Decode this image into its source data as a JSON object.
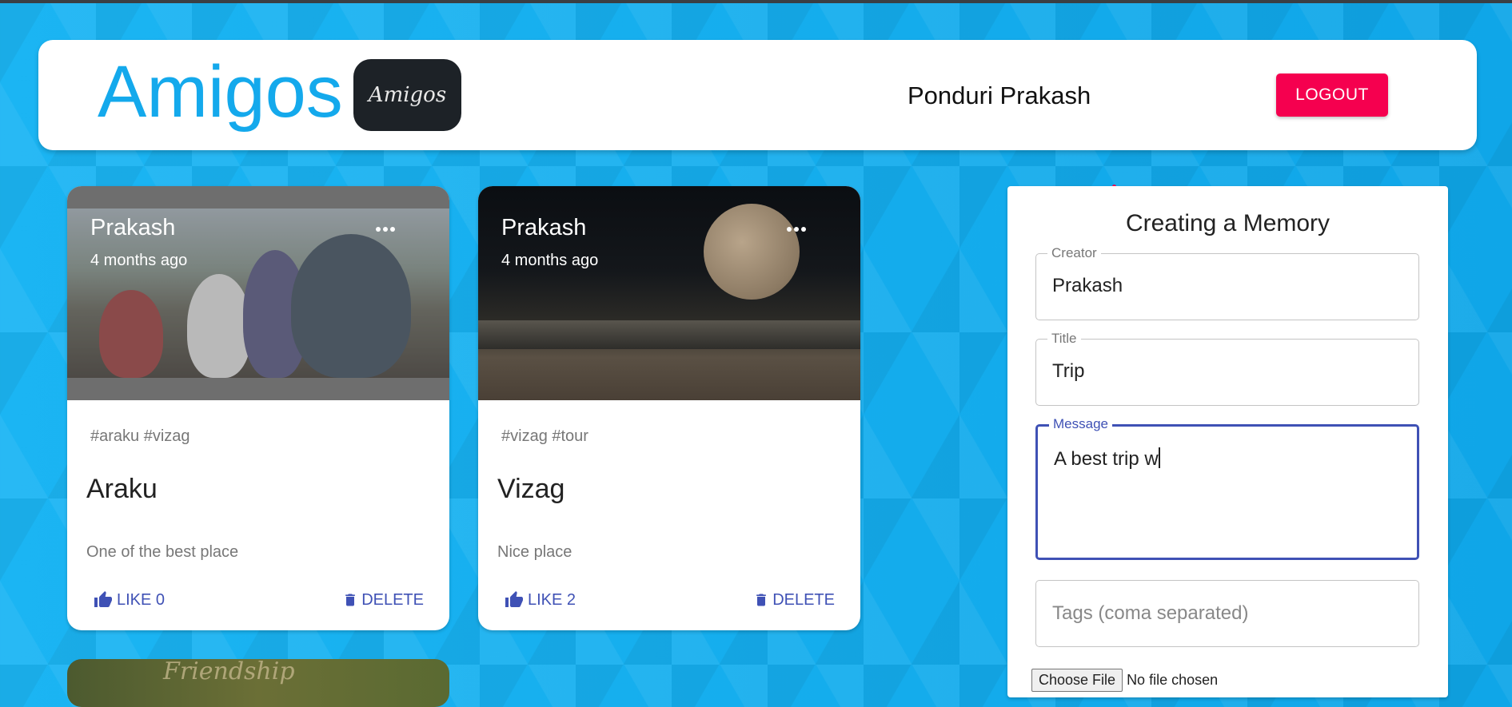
{
  "app": {
    "brand": "Amigos",
    "logo_text": "Amigos",
    "username": "Ponduri Prakash",
    "logout_label": "LOGOUT"
  },
  "posts": [
    {
      "creator": "Prakash",
      "time": "4 months ago",
      "tags": "#araku #vizag",
      "title": "Araku",
      "message": "One of the best place",
      "like_label": "LIKE 0",
      "delete_label": "DELETE"
    },
    {
      "creator": "Prakash",
      "time": "4 months ago",
      "tags": "#vizag #tour",
      "title": "Vizag",
      "message": "Nice place",
      "like_label": "LIKE 2",
      "delete_label": "DELETE"
    }
  ],
  "peek_card": {
    "text": "Friendship"
  },
  "form": {
    "title": "Creating a Memory",
    "creator": {
      "label": "Creator",
      "value": "Prakash"
    },
    "title_field": {
      "label": "Title",
      "value": "Trip"
    },
    "message": {
      "label": "Message",
      "value": "A best trip w"
    },
    "tags": {
      "placeholder": "Tags (coma separated)"
    },
    "file": {
      "button": "Choose File",
      "status": "No file chosen"
    }
  },
  "colors": {
    "background": "#18b4f2",
    "brand": "#14a9ec",
    "logout": "#f5004f",
    "primary": "#3f51b5"
  }
}
